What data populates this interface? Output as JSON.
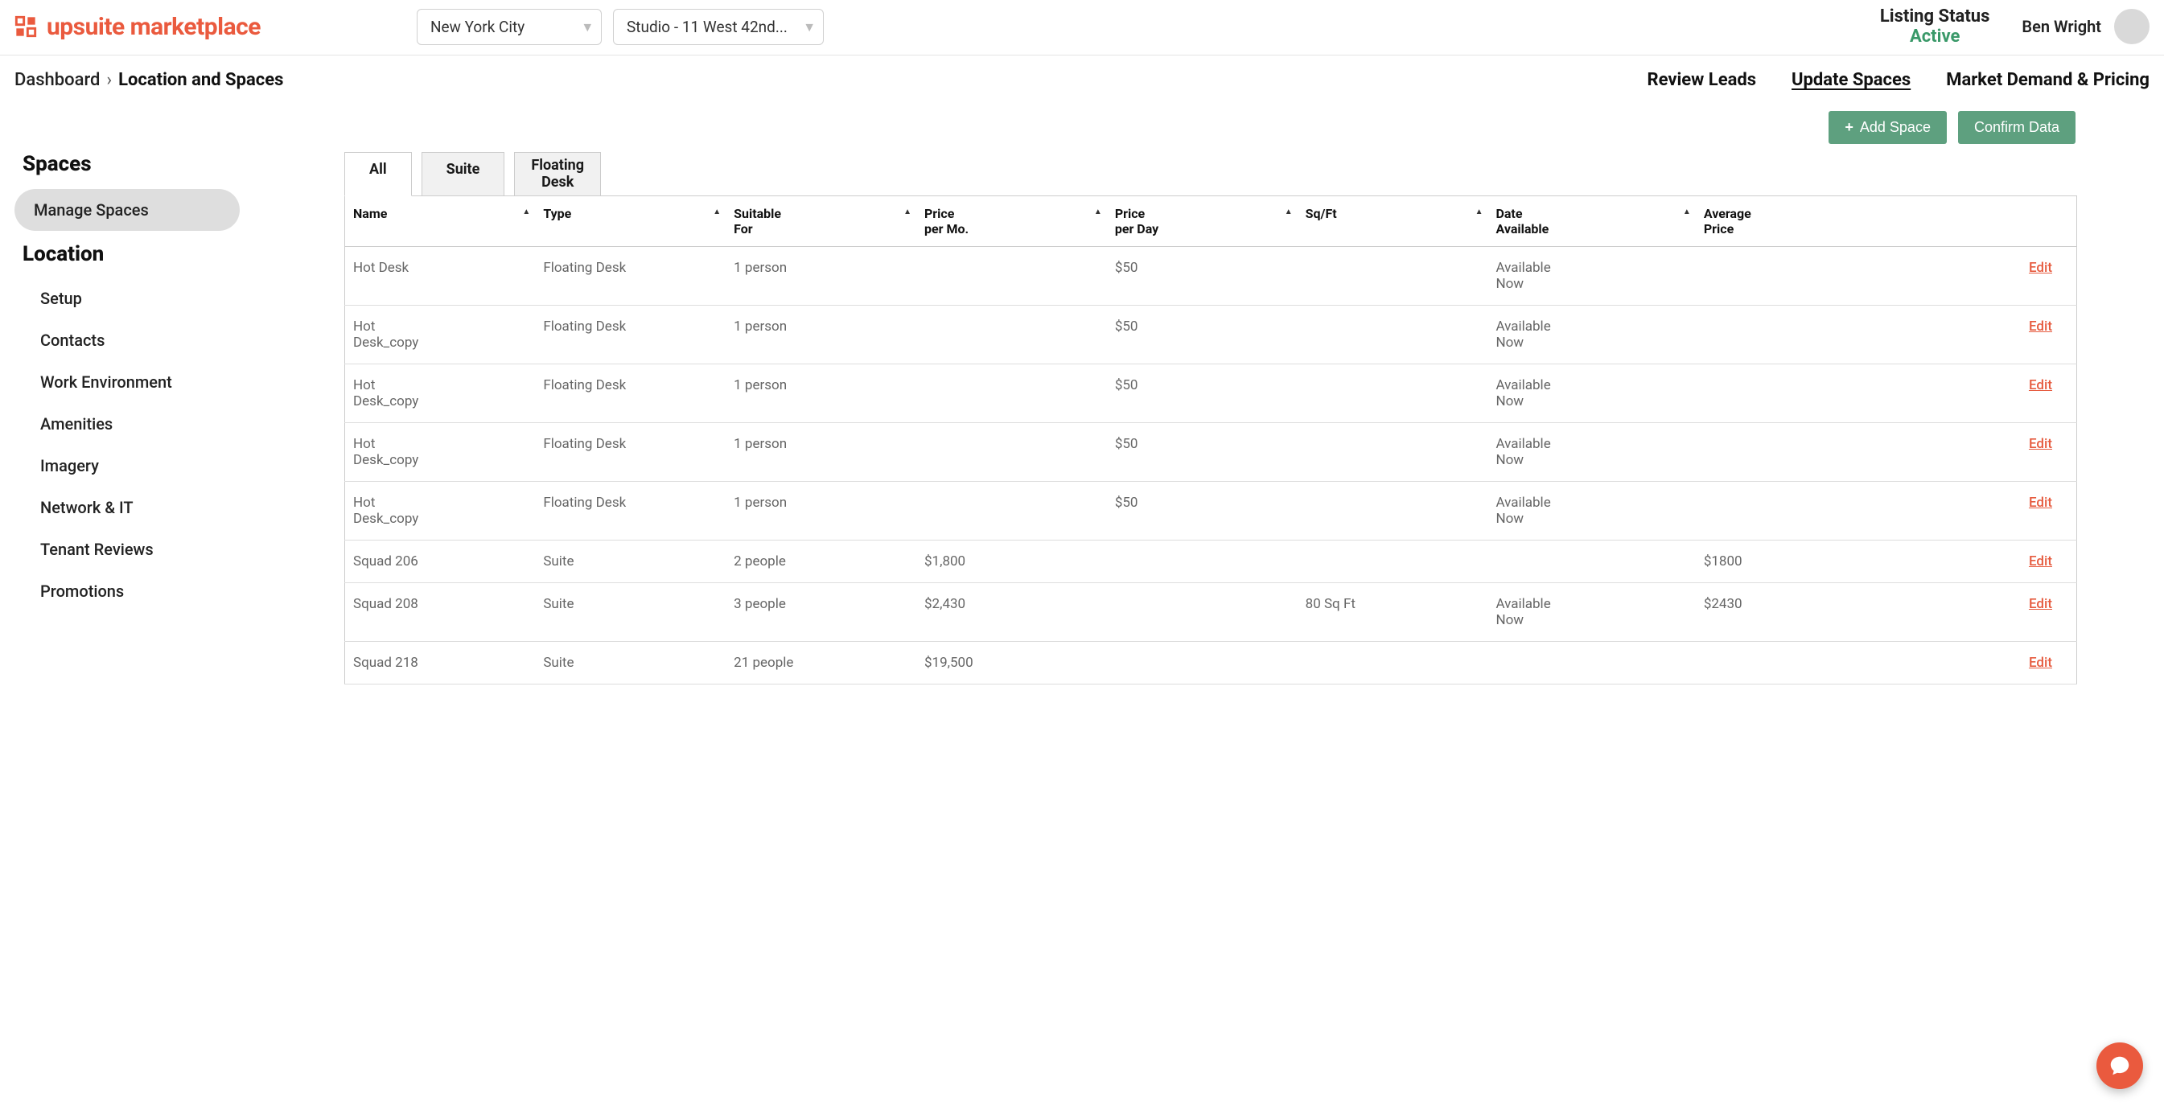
{
  "brand": {
    "name": "upsuite marketplace"
  },
  "header": {
    "city_select": "New York City",
    "location_select": "Studio - 11 West 42nd...",
    "listing_status_label": "Listing Status",
    "listing_status_value": "Active",
    "user_name": "Ben Wright"
  },
  "breadcrumb": {
    "dashboard": "Dashboard",
    "current": "Location and Spaces"
  },
  "nav_tabs": {
    "review_leads": "Review Leads",
    "update_spaces": "Update Spaces",
    "market_demand": "Market Demand & Pricing"
  },
  "actions": {
    "add_space": "Add Space",
    "confirm_data": "Confirm Data"
  },
  "sidebar": {
    "spaces_title": "Spaces",
    "manage_spaces": "Manage Spaces",
    "location_title": "Location",
    "items": [
      "Setup",
      "Contacts",
      "Work Environment",
      "Amenities",
      "Imagery",
      "Network & IT",
      "Tenant Reviews",
      "Promotions"
    ]
  },
  "filter_tabs": {
    "all": "All",
    "suite": "Suite",
    "floating_desk_l1": "Floating",
    "floating_desk_l2": "Desk"
  },
  "columns": {
    "name": "Name",
    "type": "Type",
    "suitable_for_l1": "Suitable",
    "suitable_for_l2": "For",
    "ppm_l1": "Price",
    "ppm_l2": "per Mo.",
    "ppd_l1": "Price",
    "ppd_l2": "per Day",
    "sqft": "Sq/Ft",
    "date_l1": "Date",
    "date_l2": "Available",
    "avg_l1": "Average",
    "avg_l2": "Price"
  },
  "edit_label": "Edit",
  "rows": [
    {
      "name": "Hot Desk",
      "type": "Floating Desk",
      "for": "1 person",
      "ppm": "",
      "ppd": "$50",
      "sqft": "",
      "date": "Available Now",
      "avg": ""
    },
    {
      "name": "Hot Desk_copy",
      "type": "Floating Desk",
      "for": "1 person",
      "ppm": "",
      "ppd": "$50",
      "sqft": "",
      "date": "Available Now",
      "avg": ""
    },
    {
      "name": "Hot Desk_copy",
      "type": "Floating Desk",
      "for": "1 person",
      "ppm": "",
      "ppd": "$50",
      "sqft": "",
      "date": "Available Now",
      "avg": ""
    },
    {
      "name": "Hot Desk_copy",
      "type": "Floating Desk",
      "for": "1 person",
      "ppm": "",
      "ppd": "$50",
      "sqft": "",
      "date": "Available Now",
      "avg": ""
    },
    {
      "name": "Hot Desk_copy",
      "type": "Floating Desk",
      "for": "1 person",
      "ppm": "",
      "ppd": "$50",
      "sqft": "",
      "date": "Available Now",
      "avg": ""
    },
    {
      "name": "Squad 206",
      "type": "Suite",
      "for": "2 people",
      "ppm": "$1,800",
      "ppd": "",
      "sqft": "",
      "date": "",
      "avg": "$1800"
    },
    {
      "name": "Squad 208",
      "type": "Suite",
      "for": "3 people",
      "ppm": "$2,430",
      "ppd": "",
      "sqft": "80 Sq Ft",
      "date": "Available Now",
      "avg": "$2430"
    },
    {
      "name": "Squad 218",
      "type": "Suite",
      "for": "21 people",
      "ppm": "$19,500",
      "ppd": "",
      "sqft": "",
      "date": "",
      "avg": ""
    }
  ]
}
